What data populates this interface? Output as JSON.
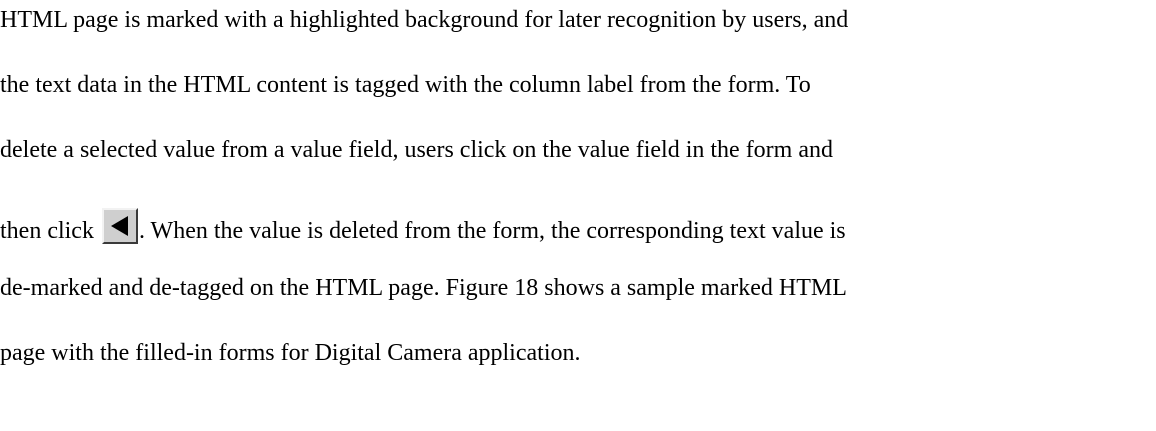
{
  "paragraph": {
    "line1": "HTML page is marked with a highlighted background for later recognition by users, and",
    "line2": "the text data in the HTML content is tagged with the column label from the form.  To",
    "line3": "delete a selected value from a value field, users click on the value field in the form and",
    "line4_before": "then click",
    "line4_after": ".  When the value is deleted from the form, the corresponding text value is",
    "line5": "de-marked and de-tagged on the HTML page.  Figure 18 shows a sample marked HTML",
    "line6": "page with the filled-in forms for Digital Camera application."
  },
  "icons": {
    "back_button": "left-triangle-icon"
  }
}
